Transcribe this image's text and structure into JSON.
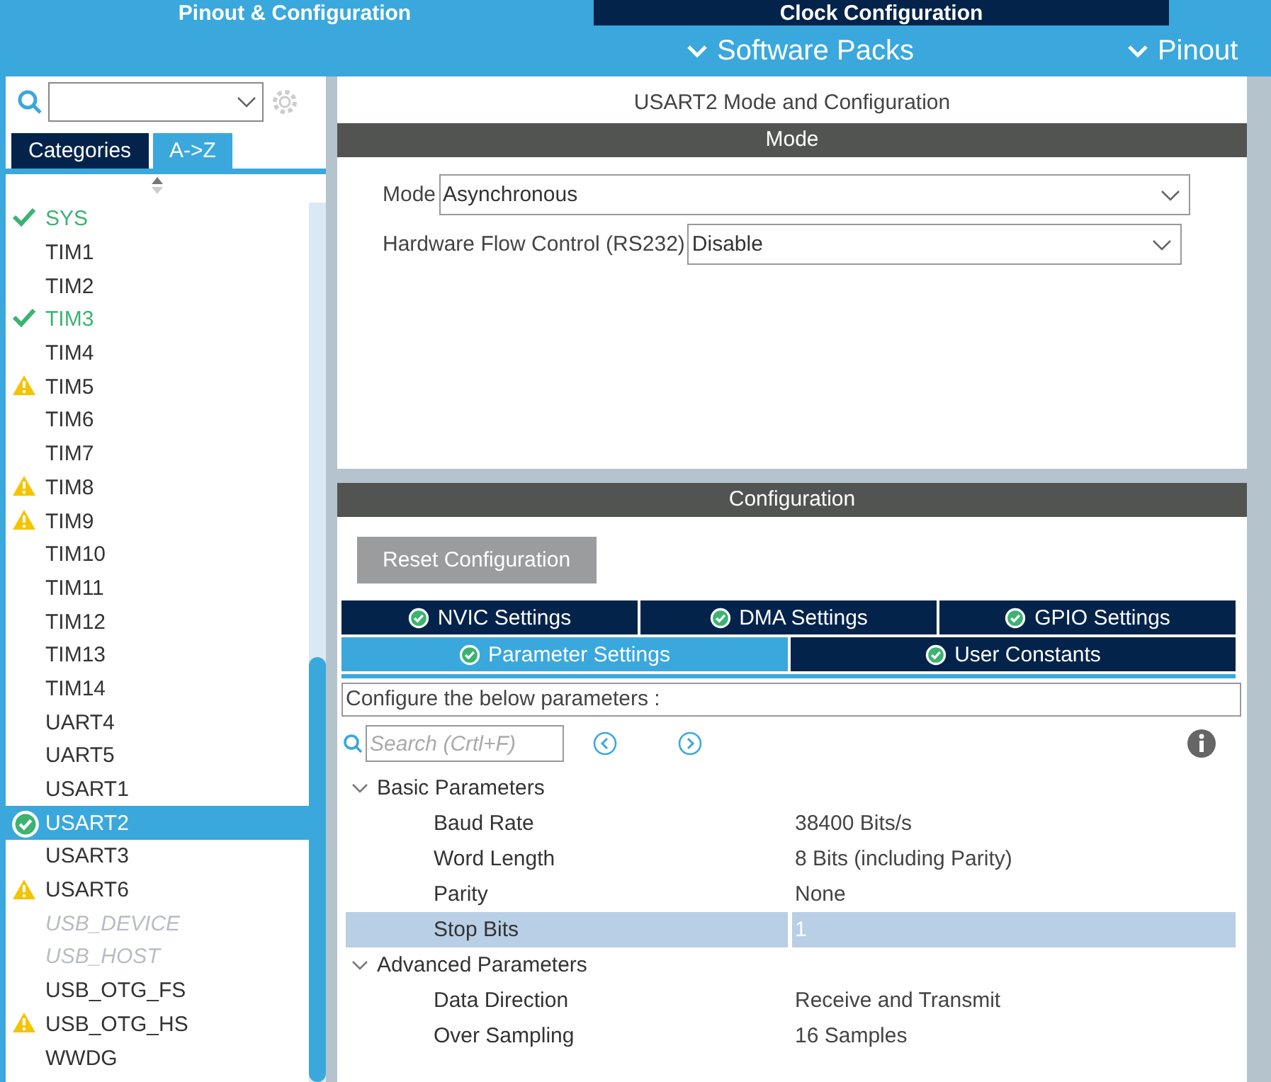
{
  "top_tabs": [
    {
      "label": "Pinout & Configuration",
      "selected": true
    },
    {
      "label": "Clock Configuration",
      "selected": false
    }
  ],
  "sub_menu": [
    "Software Packs",
    "Pinout"
  ],
  "sidebar": {
    "view_tabs": [
      {
        "label": "Categories",
        "selected": false
      },
      {
        "label": "A->Z",
        "selected": true
      }
    ],
    "items": [
      {
        "label": "SYS",
        "kind": "ok",
        "selected": false,
        "disabled": false
      },
      {
        "label": "TIM1",
        "kind": "plain",
        "selected": false,
        "disabled": false
      },
      {
        "label": "TIM2",
        "kind": "plain",
        "selected": false,
        "disabled": false
      },
      {
        "label": "TIM3",
        "kind": "ok",
        "selected": false,
        "disabled": false
      },
      {
        "label": "TIM4",
        "kind": "plain",
        "selected": false,
        "disabled": false
      },
      {
        "label": "TIM5",
        "kind": "warning",
        "selected": false,
        "disabled": false
      },
      {
        "label": "TIM6",
        "kind": "plain",
        "selected": false,
        "disabled": false
      },
      {
        "label": "TIM7",
        "kind": "plain",
        "selected": false,
        "disabled": false
      },
      {
        "label": "TIM8",
        "kind": "warning",
        "selected": false,
        "disabled": false
      },
      {
        "label": "TIM9",
        "kind": "warning",
        "selected": false,
        "disabled": false
      },
      {
        "label": "TIM10",
        "kind": "plain",
        "selected": false,
        "disabled": false
      },
      {
        "label": "TIM11",
        "kind": "plain",
        "selected": false,
        "disabled": false
      },
      {
        "label": "TIM12",
        "kind": "plain",
        "selected": false,
        "disabled": false
      },
      {
        "label": "TIM13",
        "kind": "plain",
        "selected": false,
        "disabled": false
      },
      {
        "label": "TIM14",
        "kind": "plain",
        "selected": false,
        "disabled": false
      },
      {
        "label": "UART4",
        "kind": "plain",
        "selected": false,
        "disabled": false
      },
      {
        "label": "UART5",
        "kind": "plain",
        "selected": false,
        "disabled": false
      },
      {
        "label": "USART1",
        "kind": "plain",
        "selected": false,
        "disabled": false
      },
      {
        "label": "USART2",
        "kind": "ok",
        "selected": true,
        "disabled": false
      },
      {
        "label": "USART3",
        "kind": "plain",
        "selected": false,
        "disabled": false
      },
      {
        "label": "USART6",
        "kind": "warning",
        "selected": false,
        "disabled": false
      },
      {
        "label": "USB_DEVICE",
        "kind": "plain",
        "selected": false,
        "disabled": true
      },
      {
        "label": "USB_HOST",
        "kind": "plain",
        "selected": false,
        "disabled": true
      },
      {
        "label": "USB_OTG_FS",
        "kind": "plain",
        "selected": false,
        "disabled": false
      },
      {
        "label": "USB_OTG_HS",
        "kind": "warning",
        "selected": false,
        "disabled": false
      },
      {
        "label": "WWDG",
        "kind": "plain",
        "selected": false,
        "disabled": false
      }
    ]
  },
  "panel": {
    "title": "USART2 Mode and Configuration",
    "mode_header": "Mode",
    "mode_fields": [
      {
        "label": "Mode",
        "value": "Asynchronous"
      },
      {
        "label": "Hardware Flow Control (RS232)",
        "value": "Disable"
      }
    ],
    "config_header": "Configuration",
    "reset_button": "Reset Configuration",
    "tab_rows": [
      [
        {
          "label": "NVIC Settings",
          "selected": false
        },
        {
          "label": "DMA Settings",
          "selected": false
        },
        {
          "label": "GPIO Settings",
          "selected": false
        }
      ],
      [
        {
          "label": "Parameter Settings",
          "selected": true
        },
        {
          "label": "User Constants",
          "selected": false
        }
      ]
    ],
    "hint": "Configure the below parameters :",
    "search_placeholder": "Search (Crtl+F)",
    "groups": [
      {
        "label": "Basic Parameters",
        "expanded": true,
        "rows": [
          {
            "name": "Baud Rate",
            "value": "38400 Bits/s",
            "selected": false
          },
          {
            "name": "Word Length",
            "value": "8 Bits (including Parity)",
            "selected": false
          },
          {
            "name": "Parity",
            "value": "None",
            "selected": false
          },
          {
            "name": "Stop Bits",
            "value": "1",
            "selected": true
          }
        ]
      },
      {
        "label": "Advanced Parameters",
        "expanded": true,
        "rows": [
          {
            "name": "Data Direction",
            "value": "Receive and Transmit",
            "selected": false
          },
          {
            "name": "Over Sampling",
            "value": "16 Samples",
            "selected": false
          }
        ]
      }
    ]
  }
}
